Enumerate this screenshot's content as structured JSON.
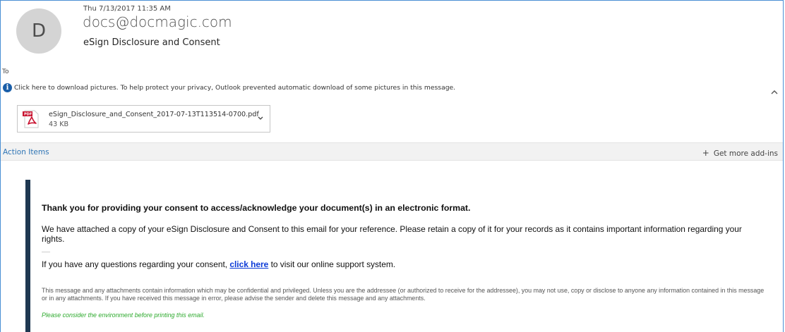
{
  "header": {
    "avatar_letter": "D",
    "date": "Thu 7/13/2017 11:35 AM",
    "sender": "docs@docmagic.com",
    "subject": "eSign Disclosure and Consent",
    "to_label": "To"
  },
  "info_bar": {
    "icon": "info-icon",
    "text": "Click here to download pictures. To help protect your privacy, Outlook prevented automatic download of some pictures in this message."
  },
  "attachment": {
    "icon": "pdf-icon",
    "name": "eSign_Disclosure_and_Consent_2017-07-13T113514-0700.pdf",
    "size": "43 KB"
  },
  "action_bar": {
    "action_items": "Action Items",
    "get_addins_plus": "+",
    "get_addins": "Get more add-ins"
  },
  "message": {
    "title": "Thank you for providing your consent to access/acknowledge your document(s) in an electronic format.",
    "paragraph1": "We have attached a copy of your eSign Disclosure and Consent to this email for your reference. Please retain a copy of it for your records as it contains important information regarding your rights.",
    "paragraph2_before": "If you have any questions regarding your consent, ",
    "paragraph2_link": "click here",
    "paragraph2_after": " to visit our online support system.",
    "disclaimer": "This message and any attachments contain information which may be confidential and privileged. Unless you are the addressee (or authorized to receive for the addressee), you may not use, copy or disclose to anyone any information contained in this message or in any attachments. If you have received this message in error, please advise the sender and delete this message and any attachments.",
    "environment": "Please consider the environment before printing this email."
  },
  "colors": {
    "frame_border": "#4a8fd4",
    "accent_bar": "#1f3851",
    "link": "#0b3ad7",
    "environment_text": "#2eaa2e",
    "action_items_text": "#2f75b5"
  }
}
